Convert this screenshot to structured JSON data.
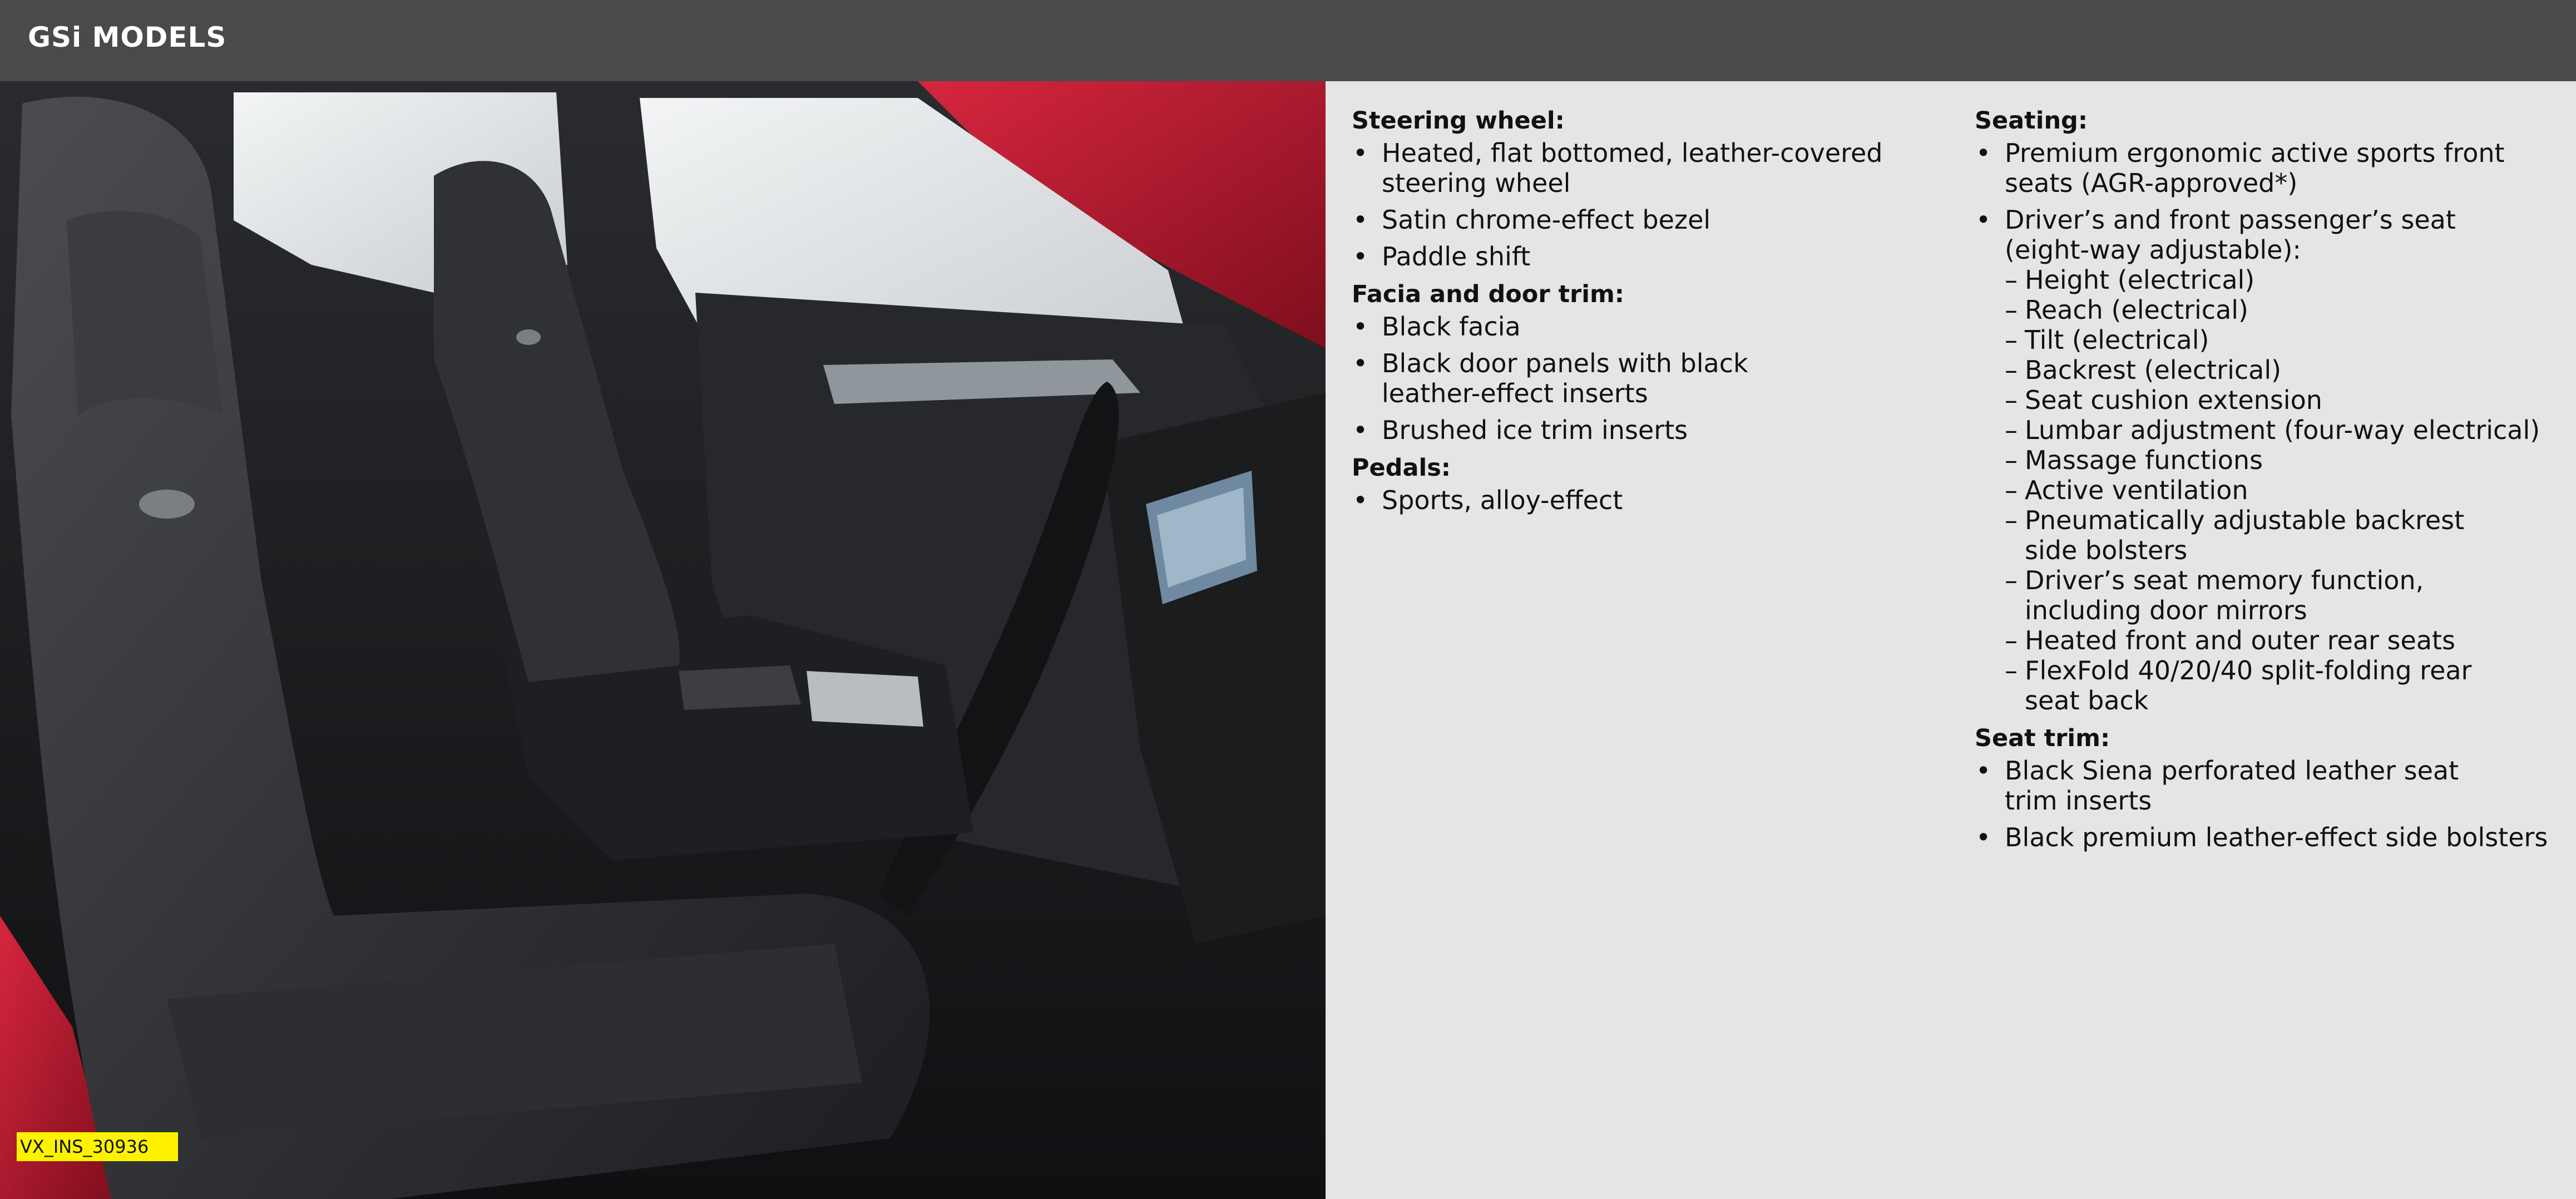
{
  "header": {
    "title": "GSi MODELS"
  },
  "image_tag": "VX_INS_30936",
  "colors": {
    "header_bg": "#4a4a4a",
    "panel_bg": "#e5e5e5",
    "tag_bg": "#fff200",
    "car_red": "#b3152a"
  },
  "spec": {
    "steering_wheel": {
      "heading": "Steering wheel:",
      "items": [
        [
          "Heated, flat bottomed, leather-covered",
          "steering wheel"
        ],
        [
          "Satin chrome-effect bezel"
        ],
        [
          "Paddle shift"
        ]
      ]
    },
    "facia": {
      "heading": "Facia and door trim:",
      "items": [
        [
          "Black facia"
        ],
        [
          "Black door panels with black",
          "leather-effect inserts"
        ],
        [
          "Brushed ice trim inserts"
        ]
      ]
    },
    "pedals": {
      "heading": "Pedals:",
      "items": [
        [
          "Sports, alloy-effect"
        ]
      ]
    },
    "seating": {
      "heading": "Seating:",
      "item1": [
        "Premium ergonomic active sports front",
        "seats (AGR-approved*)"
      ],
      "item2": [
        "Driver’s and front passenger’s seat",
        "(eight-way adjustable):"
      ],
      "sub_items": [
        [
          "Height (electrical)"
        ],
        [
          "Reach (electrical)"
        ],
        [
          "Tilt (electrical)"
        ],
        [
          "Backrest (electrical)"
        ],
        [
          "Seat cushion extension"
        ],
        [
          "Lumbar adjustment (four-way electrical)"
        ],
        [
          "Massage functions"
        ],
        [
          "Active ventilation"
        ],
        [
          "Pneumatically adjustable backrest",
          "side bolsters"
        ],
        [
          "Driver’s seat memory function,",
          "including door mirrors"
        ],
        [
          "Heated front and outer rear seats"
        ],
        [
          "FlexFold 40/20/40 split-folding rear",
          "seat back"
        ]
      ]
    },
    "seat_trim": {
      "heading": "Seat trim:",
      "items": [
        [
          "Black Siena perforated leather seat",
          "trim inserts"
        ],
        [
          "Black premium leather-effect side bolsters"
        ]
      ]
    }
  }
}
